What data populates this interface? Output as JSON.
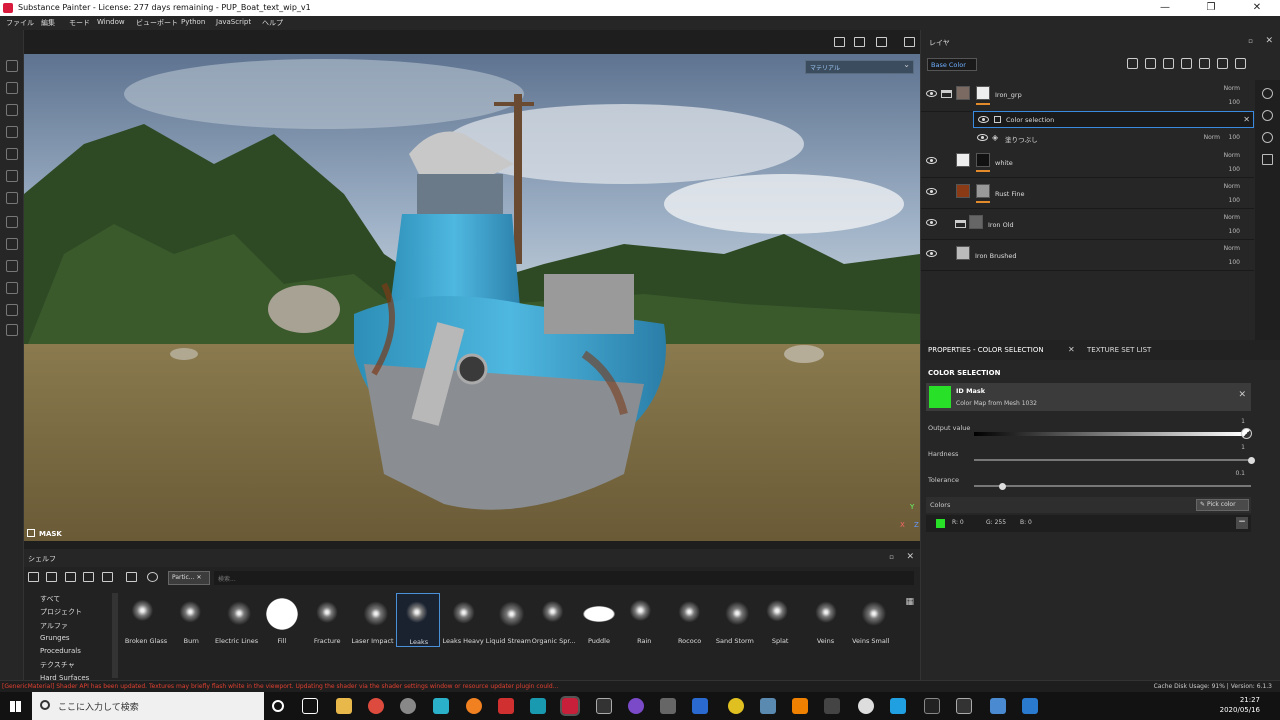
{
  "window": {
    "title": "Substance Painter - License: 277 days remaining - PUP_Boat_text_wip_v1",
    "minimize": "—",
    "maximize": "❐",
    "close": "✕"
  },
  "menu": [
    "ファイル",
    "編集",
    "モード",
    "Window",
    "ビューポート",
    "Python",
    "JavaScript",
    "ヘルプ"
  ],
  "viewport": {
    "material_dropdown": "マテリアル",
    "mask_label": "MASK",
    "axis_y": "Y",
    "axis_x": "X",
    "axis_z": "Z"
  },
  "shelf": {
    "title": "シェルフ",
    "filter_tag": "Partic...",
    "filter_close": "✕",
    "search_placeholder": "検索...",
    "categories": [
      "すべて",
      "プロジェクト",
      "アルファ",
      "Grunges",
      "Procedurals",
      "テクスチャ",
      "Hard Surfaces"
    ],
    "brushes": [
      "Broken Glass",
      "Burn",
      "Electric Lines",
      "Fill",
      "Fracture",
      "Laser Impact",
      "Leaks",
      "Leaks Heavy",
      "Liquid Stream",
      "Organic Spr...",
      "Puddle",
      "Rain",
      "Rococo",
      "Sand Storm",
      "Splat",
      "Veins",
      "Veins Small"
    ],
    "selected_brush": "Leaks"
  },
  "layers": {
    "title": "レイヤ",
    "channel": "Base Color",
    "items": [
      {
        "name": "Iron_grp",
        "blend": "Norm",
        "opacity": "100"
      },
      {
        "name": "Color selection"
      },
      {
        "name": "塗りつぶし",
        "blend": "Norm",
        "opacity": "100"
      },
      {
        "name": "white",
        "blend": "Norm",
        "opacity": "100"
      },
      {
        "name": "Rust Fine",
        "blend": "Norm",
        "opacity": "100"
      },
      {
        "name": "Iron Old",
        "blend": "Norm",
        "opacity": "100"
      },
      {
        "name": "Iron Brushed",
        "blend": "Norm",
        "opacity": "100"
      }
    ]
  },
  "properties": {
    "tab_active": "PROPERTIES - COLOR SELECTION",
    "tab_close": "✕",
    "tab_other": "TEXTURE SET LIST",
    "section": "COLOR SELECTION",
    "id_mask_name": "ID Mask",
    "id_mask_desc": "Color Map from Mesh 1032",
    "id_mask_close": "✕",
    "output_label": "Output value",
    "output_value": "1",
    "output_level": 1.0,
    "hardness_label": "Hardness",
    "hardness_value": "1",
    "hardness_level": 1.0,
    "tolerance_label": "Tolerance",
    "tolerance_value": "0.1",
    "tolerance_level": 0.1,
    "colors_label": "Colors",
    "pick_color": "Pick color",
    "r": "R: 0",
    "g": "G: 255",
    "b": "B: 0",
    "minus": "−",
    "color_hex": "#28e028"
  },
  "status": {
    "error": "[GenericMaterial] Shader API has been updated. Textures may briefly flash white in the viewport. Updating the shader via the shader settings window or resource updater plugin could...",
    "cache": "Cache Disk Usage:   91%  |  Version: 6.1.3"
  },
  "taskbar": {
    "search_placeholder": "ここに入力して検索",
    "time": "21:27",
    "date": "2020/05/16"
  }
}
